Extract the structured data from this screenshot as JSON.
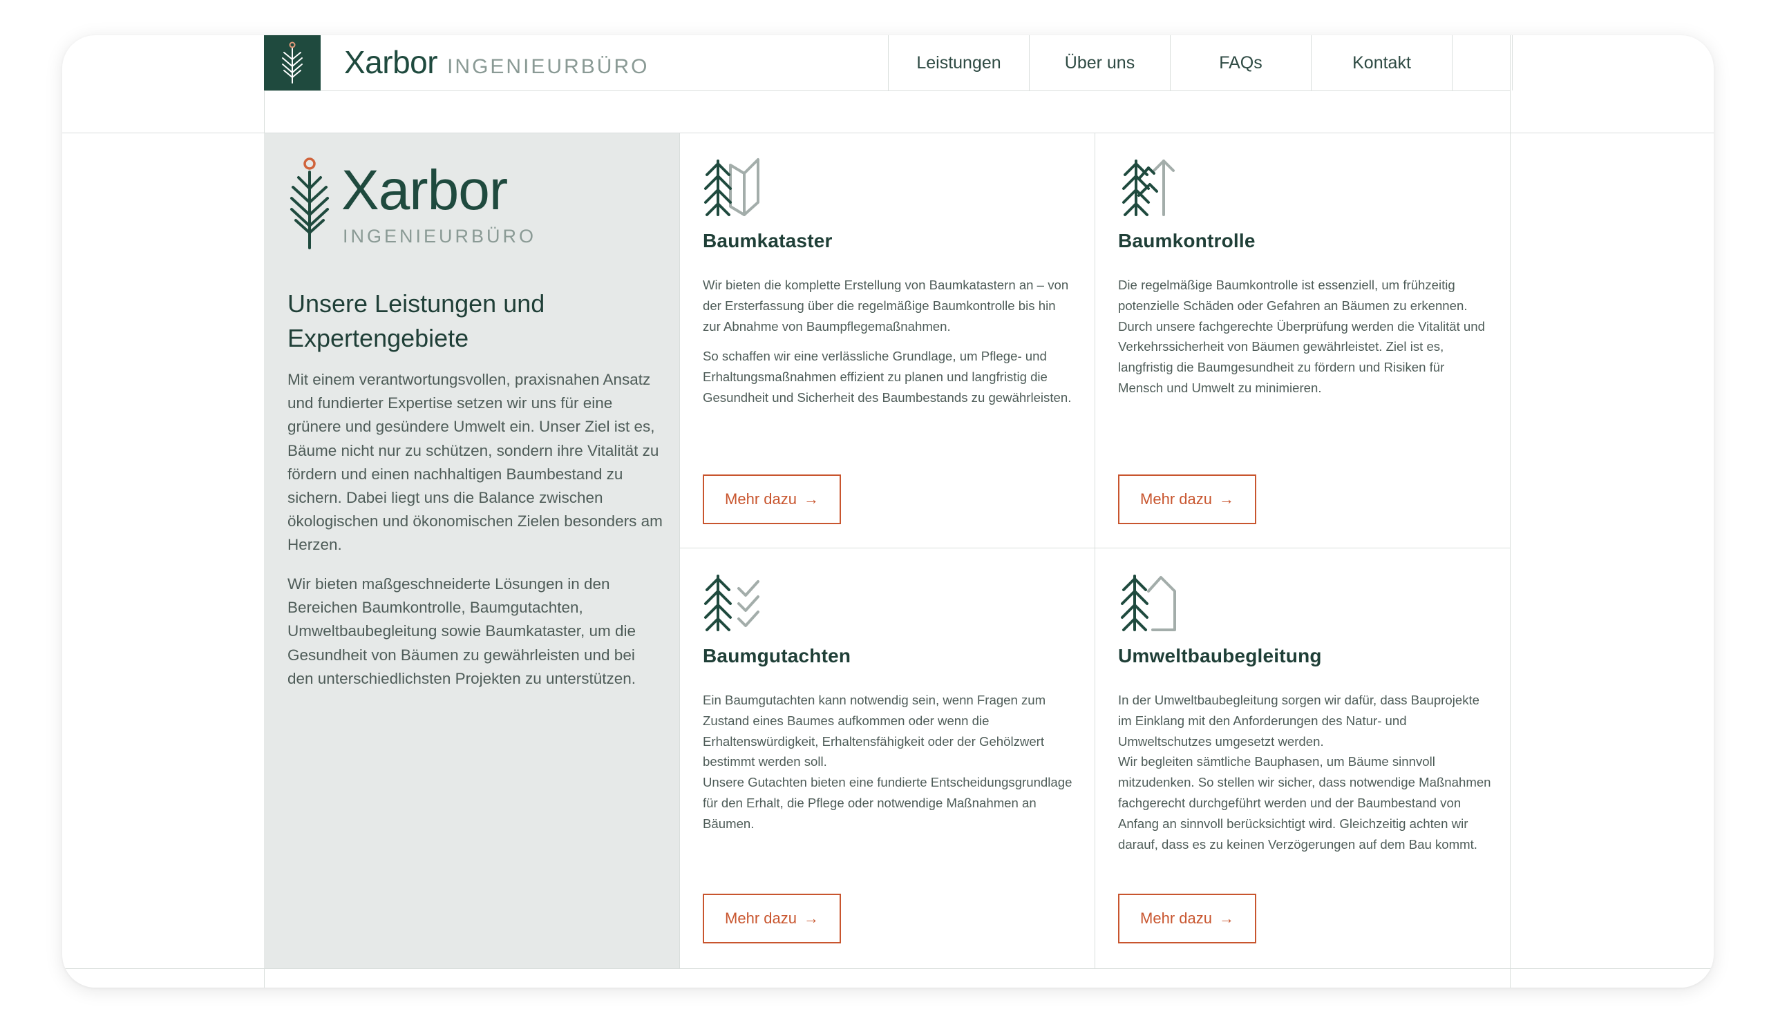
{
  "header": {
    "brand_name": "Xarbor",
    "brand_sub": "INGENIEURBÜRO",
    "nav": [
      "Leistungen",
      "Über uns",
      "FAQs",
      "Kontakt"
    ]
  },
  "intro": {
    "logo_name": "Xarbor",
    "logo_sub": "INGENIEURBÜRO",
    "heading": "Unsere Leistungen und Expertengebiete",
    "paragraph1": "Mit einem verantwortungsvollen, praxisnahen Ansatz und fundierter Expertise setzen wir uns für eine grünere und gesündere Umwelt ein. Unser Ziel ist es, Bäume nicht nur zu schützen, sondern ihre Vitalität zu fördern und einen nachhaltigen Baumbestand zu sichern. Dabei liegt uns die Balance zwischen ökologischen und ökonomischen Zielen besonders am Herzen.",
    "paragraph2": "Wir bieten maßgeschneiderte Lösungen in den Bereichen Baumkontrolle, Baumgutachten, Umweltbaubegleitung sowie Baumkataster, um die Gesundheit von Bäumen zu gewährleisten und bei den unterschiedlichsten Projekten zu unterstützen."
  },
  "services": [
    {
      "title": "Baumkataster",
      "icon": "tree-map-icon",
      "paragraphs": [
        "Wir bieten die komplette Erstellung von Baumkatastern an – von der Ersterfassung über die regelmäßige Baumkontrolle bis hin zur Abnahme von Baumpflegemaßnahmen.",
        "So schaffen wir eine verlässliche Grundlage, um Pflege- und Erhaltungsmaßnahmen effizient zu planen und langfristig die Gesundheit und Sicherheit des Baumbestands zu gewährleisten."
      ],
      "button": "Mehr dazu"
    },
    {
      "title": "Baumkontrolle",
      "icon": "tree-arrow-up-icon",
      "paragraphs": [
        "Die regelmäßige Baumkontrolle ist essenziell, um frühzeitig potenzielle Schäden oder Gefahren an Bäumen zu erkennen.\nDurch unsere fachgerechte Überprüfung werden die Vitalität und Verkehrssicherheit von Bäumen gewährleistet. Ziel ist es, langfristig die Baumgesundheit zu fördern und Risiken für Mensch und Umwelt zu minimieren."
      ],
      "button": "Mehr dazu"
    },
    {
      "title": "Baumgutachten",
      "icon": "tree-checks-icon",
      "paragraphs": [
        "Ein Baumgutachten kann notwendig sein, wenn Fragen zum Zustand eines Baumes aufkommen oder wenn die Erhaltenswürdigkeit, Erhaltensfähigkeit oder der Gehölzwert bestimmt werden soll.\nUnsere Gutachten bieten eine fundierte Entscheidungsgrundlage für den Erhalt, die Pflege oder notwendige Maßnahmen an Bäumen."
      ],
      "button": "Mehr dazu"
    },
    {
      "title": "Umweltbaubegleitung",
      "icon": "tree-house-icon",
      "paragraphs": [
        "In der Umweltbaubegleitung sorgen wir dafür, dass Bauprojekte im Einklang mit den Anforderungen des Natur- und Umweltschutzes umgesetzt werden.\nWir begleiten sämtliche Bauphasen, um Bäume sinnvoll mitzudenken. So stellen wir sicher, dass notwendige Maßnahmen fachgerecht durchgeführt werden und der Baumbestand von Anfang an sinnvoll berücksichtigt wird. Gleichzeitig achten wir darauf, dass es zu keinen Verzögerungen auf dem Bau kommt."
      ],
      "button": "Mehr dazu"
    }
  ],
  "colors": {
    "brand_green": "#1f4a3e",
    "accent_orange": "#c8552e",
    "intro_bg": "#e6e9e8",
    "line": "#d9dedc"
  }
}
